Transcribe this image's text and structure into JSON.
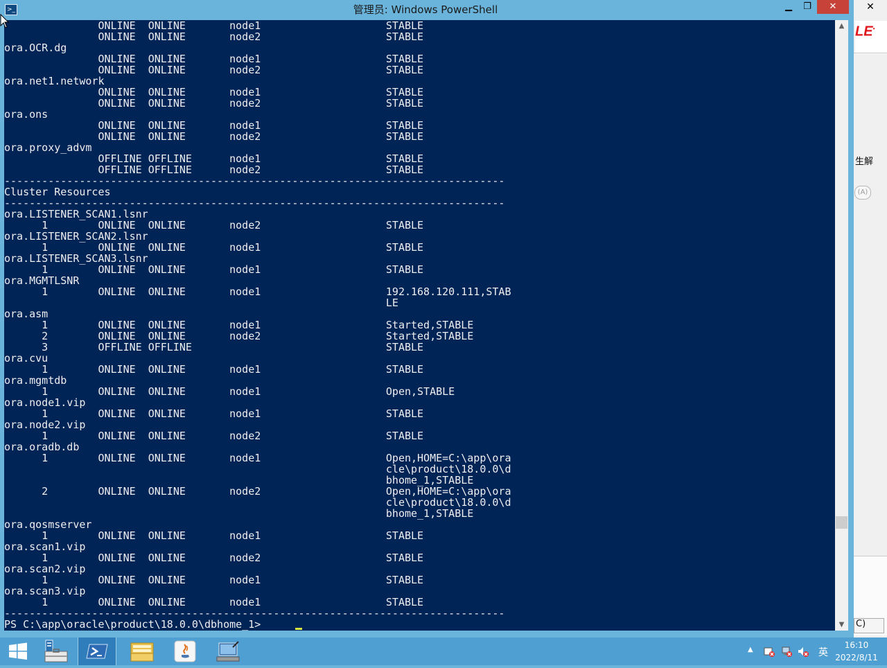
{
  "window": {
    "title": "管理员: Windows PowerShell",
    "minimize_label": "▁",
    "maximize_label": "❐",
    "close_label": "✕"
  },
  "background_app": {
    "logo_text": "LE",
    "text_fragment": "生解",
    "pill_text": "(A)",
    "bottom_text": "C)",
    "outer_close": "✕"
  },
  "console": {
    "lines": [
      "               ONLINE  ONLINE       node1                    STABLE",
      "               ONLINE  ONLINE       node2                    STABLE",
      "ora.OCR.dg",
      "               ONLINE  ONLINE       node1                    STABLE",
      "               ONLINE  ONLINE       node2                    STABLE",
      "ora.net1.network",
      "               ONLINE  ONLINE       node1                    STABLE",
      "               ONLINE  ONLINE       node2                    STABLE",
      "ora.ons",
      "               ONLINE  ONLINE       node1                    STABLE",
      "               ONLINE  ONLINE       node2                    STABLE",
      "ora.proxy_advm",
      "               OFFLINE OFFLINE      node1                    STABLE",
      "               OFFLINE OFFLINE      node2                    STABLE",
      "--------------------------------------------------------------------------------",
      "Cluster Resources",
      "--------------------------------------------------------------------------------",
      "ora.LISTENER_SCAN1.lsnr",
      "      1        ONLINE  ONLINE       node2                    STABLE",
      "ora.LISTENER_SCAN2.lsnr",
      "      1        ONLINE  ONLINE       node1                    STABLE",
      "ora.LISTENER_SCAN3.lsnr",
      "      1        ONLINE  ONLINE       node1                    STABLE",
      "ora.MGMTLSNR",
      "      1        ONLINE  ONLINE       node1                    192.168.120.111,STAB",
      "                                                             LE",
      "ora.asm",
      "      1        ONLINE  ONLINE       node1                    Started,STABLE",
      "      2        ONLINE  ONLINE       node2                    Started,STABLE",
      "      3        OFFLINE OFFLINE                               STABLE",
      "ora.cvu",
      "      1        ONLINE  ONLINE       node1                    STABLE",
      "ora.mgmtdb",
      "      1        ONLINE  ONLINE       node1                    Open,STABLE",
      "ora.node1.vip",
      "      1        ONLINE  ONLINE       node1                    STABLE",
      "ora.node2.vip",
      "      1        ONLINE  ONLINE       node2                    STABLE",
      "ora.oradb.db",
      "      1        ONLINE  ONLINE       node1                    Open,HOME=C:\\app\\ora",
      "                                                             cle\\product\\18.0.0\\d",
      "                                                             bhome_1,STABLE",
      "      2        ONLINE  ONLINE       node2                    Open,HOME=C:\\app\\ora",
      "                                                             cle\\product\\18.0.0\\d",
      "                                                             bhome_1,STABLE",
      "ora.qosmserver",
      "      1        ONLINE  ONLINE       node1                    STABLE",
      "ora.scan1.vip",
      "      1        ONLINE  ONLINE       node2                    STABLE",
      "ora.scan2.vip",
      "      1        ONLINE  ONLINE       node1                    STABLE",
      "ora.scan3.vip",
      "      1        ONLINE  ONLINE       node1                    STABLE",
      "--------------------------------------------------------------------------------",
      "PS C:\\app\\oracle\\product\\18.0.0\\dbhome_1> "
    ]
  },
  "scrollbar": {
    "up_arrow": "▲",
    "down_arrow": "▼"
  },
  "taskbar": {
    "items": [
      "start-button",
      "server-manager",
      "windows-powershell",
      "file-explorer",
      "java",
      "network-app"
    ],
    "tray_chevron": "▲",
    "ime": "英",
    "time": "16:10",
    "date": "2022/8/11"
  },
  "colors": {
    "console_bg": "#012456",
    "console_fg": "#eeedf0",
    "window_frame": "#6ab4dc",
    "taskbar": "#4f9fd2",
    "close_button": "#c7433a"
  }
}
